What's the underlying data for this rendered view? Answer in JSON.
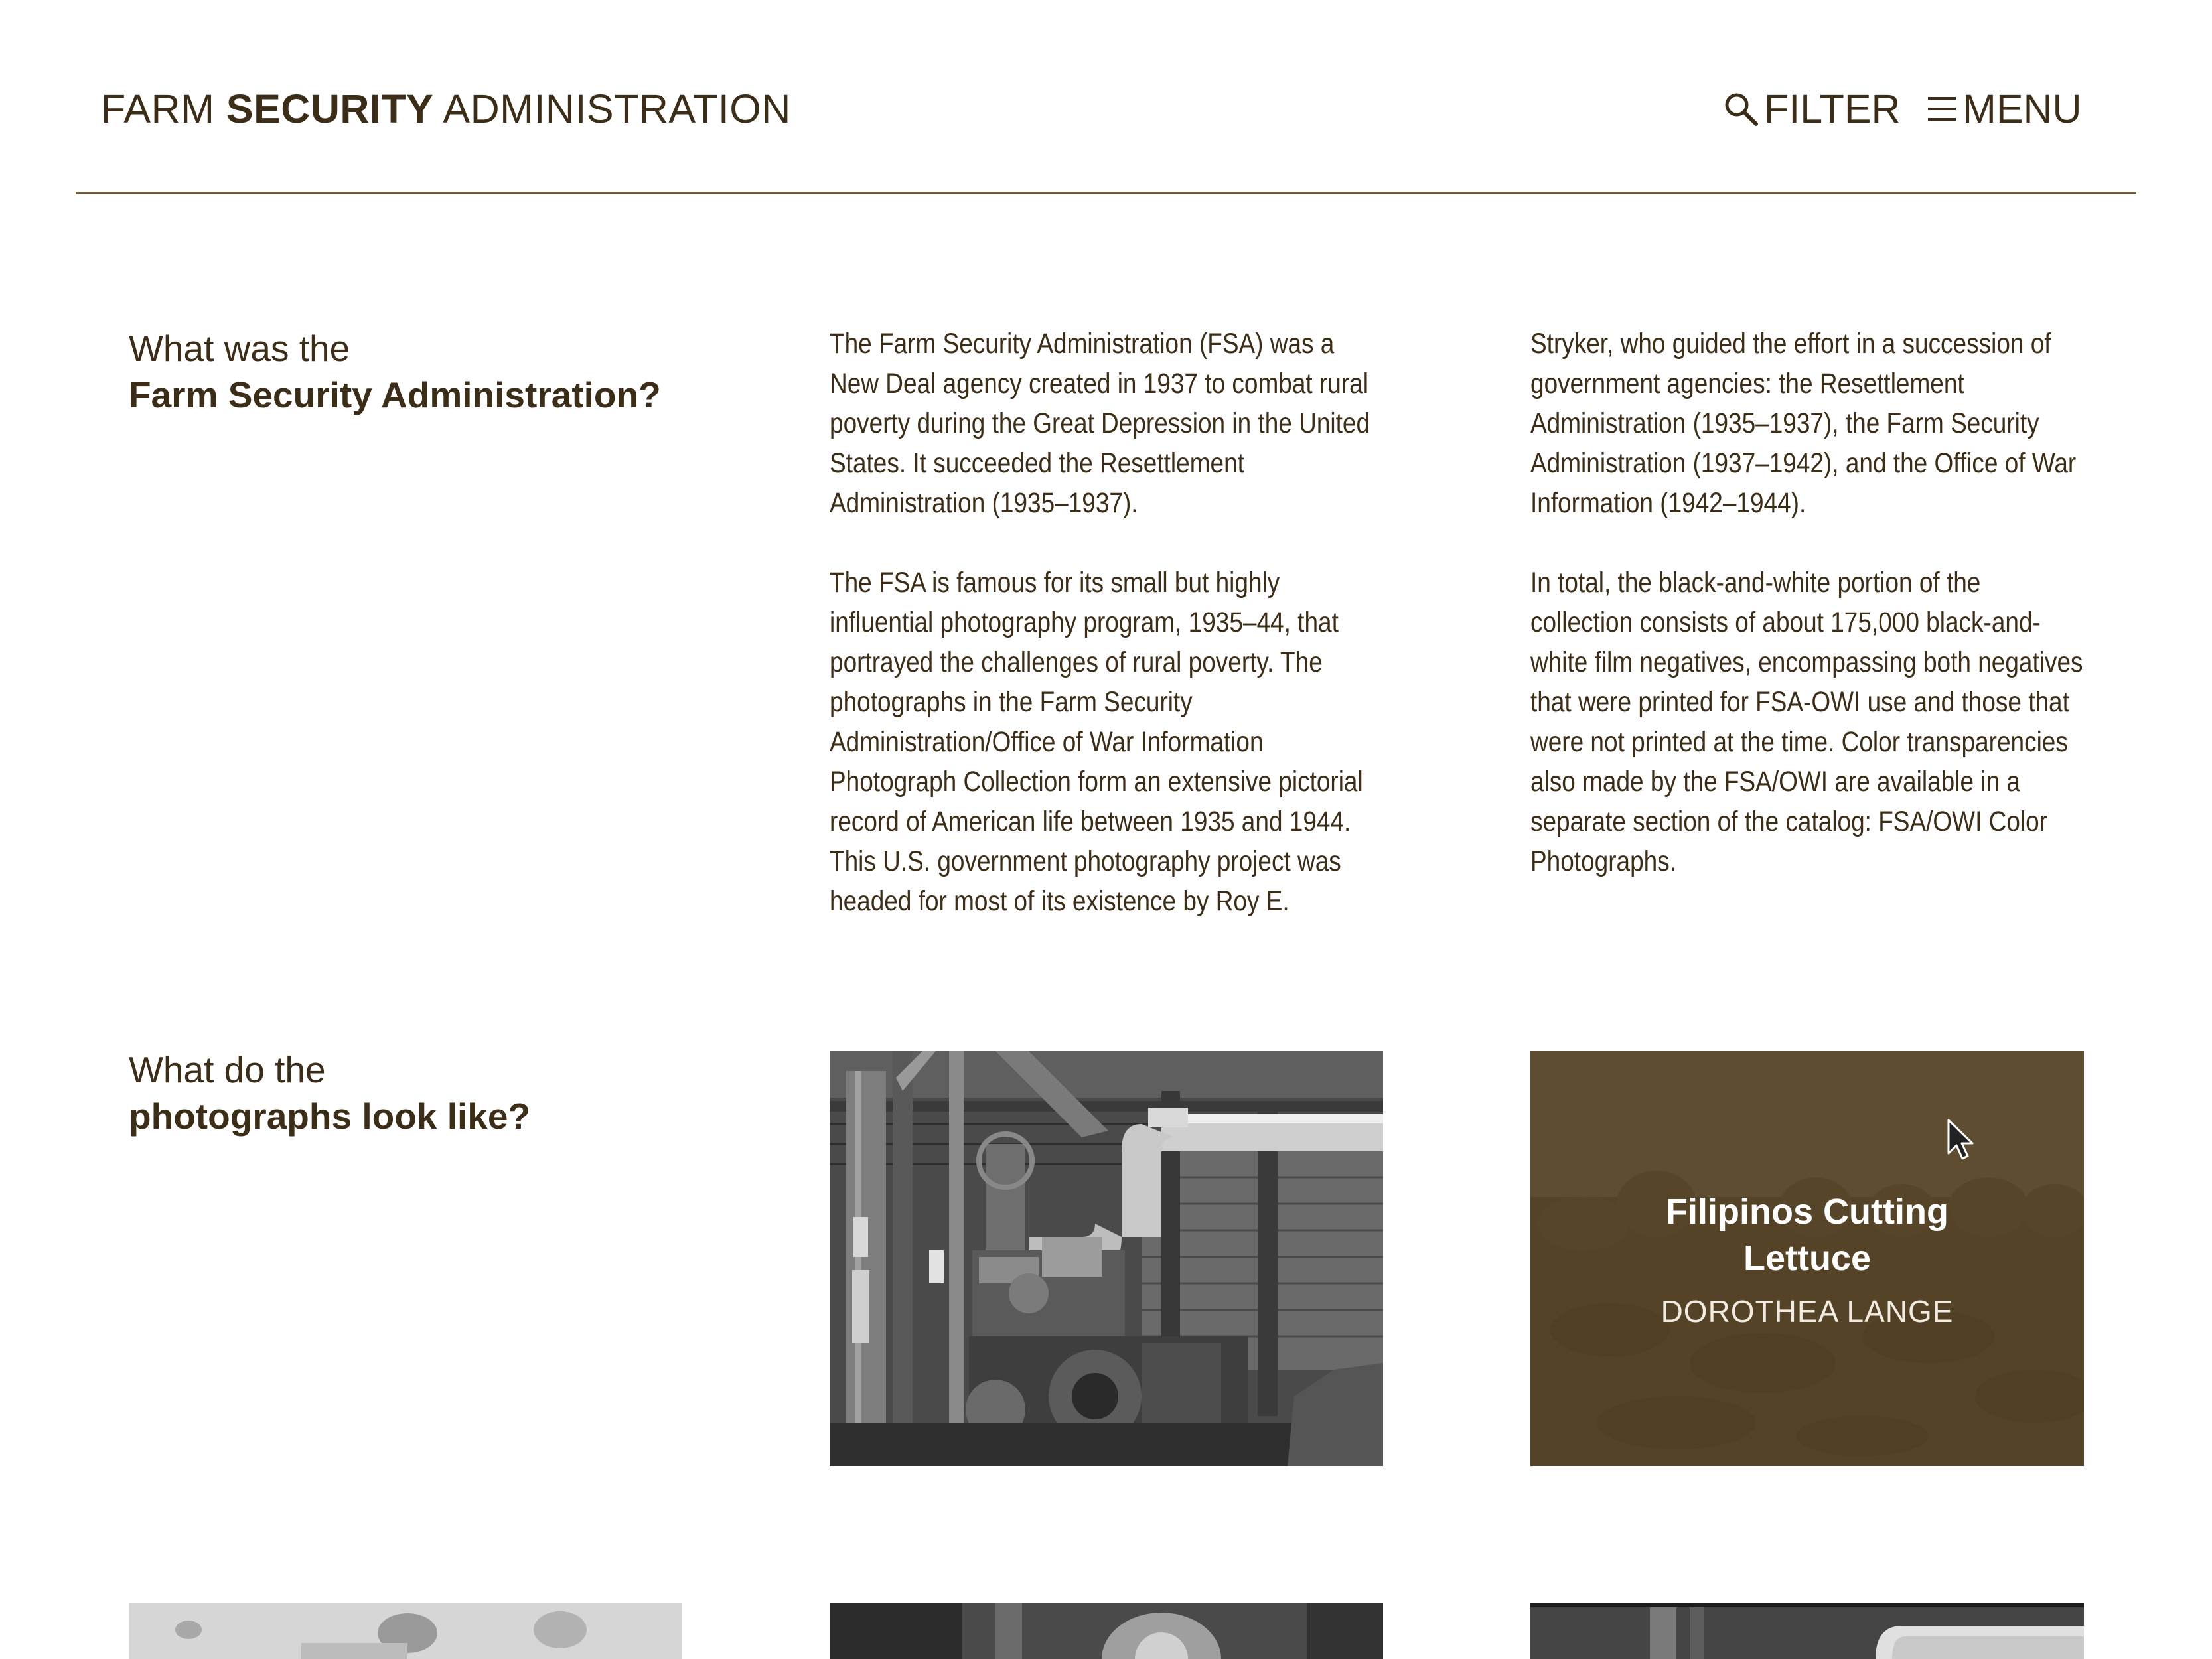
{
  "header": {
    "logo_part1": "FARM ",
    "logo_part2": "SECURITY",
    "logo_part3": " ADMINISTRATION",
    "filter_label": "FILTER",
    "menu_label": "MENU"
  },
  "section1": {
    "heading_light": "What was the",
    "heading_bold": "Farm Security Administration?",
    "col2": [
      "The Farm Security Administration (FSA) was a New Deal agency created in 1937 to combat rural poverty during the Great Depression in the United States. It succeeded the Resettlement Administration (1935–1937).",
      "The FSA is famous for its small but highly influential photography program, 1935–44, that portrayed the challenges of rural poverty. The photographs in the Farm Security Administration/Office of War Information Photograph Collection form an extensive pictorial record of American life between 1935 and 1944. This U.S. government photography project was headed for most of its existence by Roy E."
    ],
    "col3": [
      "Stryker, who guided the effort in a succession of government agencies: the Resettlement Administration (1935–1937), the Farm Security Administration (1937–1942), and the Office of War Information (1942–1944).",
      "In total, the black-and-white portion of the collection consists of about 175,000 black-and-white film negatives, encompassing both negatives that were printed for FSA-OWI use and those that were not printed at the time. Color transparencies also made by the FSA/OWI are available in a separate section of the catalog: FSA/OWI Color Photographs."
    ]
  },
  "section2": {
    "heading_light": "What do the",
    "heading_bold": "photographs look like?",
    "hover_photo": {
      "title": "Filipinos Cutting Lettuce",
      "credit": "DOROTHEA LANGE"
    }
  },
  "colors": {
    "brand_brown": "#3b2d17",
    "overlay": "#543f1f",
    "rule": "#6b5d42"
  },
  "icons": {
    "filter": "search-icon",
    "menu": "hamburger-icon"
  }
}
